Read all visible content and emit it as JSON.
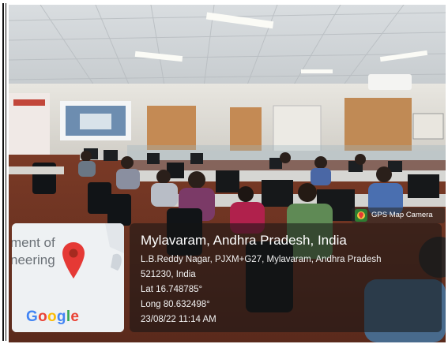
{
  "map_card": {
    "snippet_line1": "ment of",
    "snippet_line2": "neering",
    "logo": "Google",
    "logo_letters": [
      {
        "ch": "G",
        "color": "#4285F4"
      },
      {
        "ch": "o",
        "color": "#EA4335"
      },
      {
        "ch": "o",
        "color": "#FBBC05"
      },
      {
        "ch": "g",
        "color": "#4285F4"
      },
      {
        "ch": "l",
        "color": "#34A853"
      },
      {
        "ch": "e",
        "color": "#EA4335"
      }
    ],
    "pin_icon": "map-pin-icon",
    "pin_color": "#e53935"
  },
  "badge": {
    "icon": "camera-icon",
    "label": "GPS Map Camera"
  },
  "location": {
    "title": "Mylavaram, Andhra Pradesh, India",
    "address_line1": "L.B.Reddy Nagar, PJXM+G27, Mylavaram, Andhra Pradesh",
    "address_line2": "521230, India",
    "lat": "Lat 16.748785°",
    "long": "Long 80.632498°",
    "timestamp": "23/08/22 11:14 AM"
  }
}
